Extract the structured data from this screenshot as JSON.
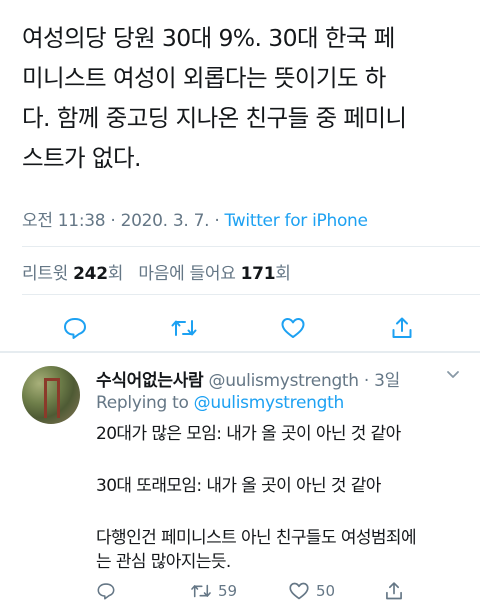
{
  "tweet": {
    "text": "여성의당 당원 30대 9%. 30대 한국 페\n미니스트 여성이 외롭다는 뜻이기도 하\n다. 함께 중고딩 지나온 친구들 중 페미니\n스트가 없다.",
    "time": "오전 11:38",
    "sep1": " · ",
    "date": "2020. 3. 7.",
    "sep2": " · ",
    "source": "Twitter for iPhone",
    "retweets_label": "리트윗",
    "retweets_count": "242",
    "retweets_unit": "회",
    "likes_label": "마음에 들어요",
    "likes_count": "171",
    "likes_unit": "회"
  },
  "reply": {
    "name": "수식어없는사람",
    "handle": "@uulismystrength",
    "sep": " · ",
    "age": "3일",
    "replying_prefix": "Replying to",
    "replying_to": "@uulismystrength",
    "line1": "20대가 많은 모임: 내가 올 곳이 아닌 것 같아",
    "line2": "30대 또래모임: 내가 올 곳이 아닌 것 같아",
    "line3": "다행인건 페미니스트 아닌 친구들도 여성범죄에",
    "line4": "는 관심 많아지는듯.",
    "retweet_count": "59",
    "like_count": "50"
  },
  "icons": {
    "reply": "reply-icon",
    "retweet": "retweet-icon",
    "like": "heart-icon",
    "share": "share-icon",
    "caret": "chevron-down-icon"
  },
  "colors": {
    "link": "#1da1f2",
    "secondary": "#657786",
    "text": "#14171a",
    "divider": "#e6ecf0"
  }
}
